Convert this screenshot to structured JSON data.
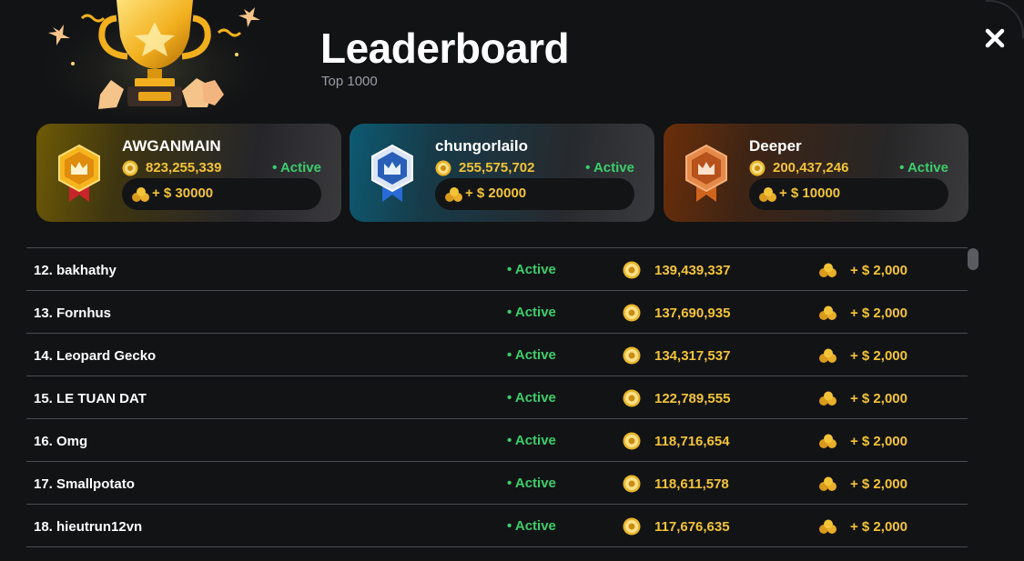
{
  "header": {
    "title": "Leaderboard",
    "subtitle": "Top 1000"
  },
  "icons": {
    "trophy": "trophy-illustration",
    "close": "close-icon",
    "coin": "coin-icon",
    "prize": "prize-coins-icon",
    "gold_badge": "gold-rank-badge",
    "silver_badge": "blue-rank-badge",
    "bronze_badge": "bronze-rank-badge"
  },
  "colors": {
    "gold": "#f3c437",
    "active_green": "#3ccd6c",
    "background": "#121315"
  },
  "top_three": [
    {
      "name": "AWGANMAIN",
      "score": "823,255,339",
      "status": "• Active",
      "prize": "+ $ 30000"
    },
    {
      "name": "chungorlailo",
      "score": "255,575,702",
      "status": "• Active",
      "prize": "+ $ 20000"
    },
    {
      "name": "Deeper",
      "score": "200,437,246",
      "status": "• Active",
      "prize": "+ $ 10000"
    }
  ],
  "rows": [
    {
      "name": "12. bakhathy",
      "status": "• Active",
      "score": "139,439,337",
      "prize": "+ $ 2,000"
    },
    {
      "name": "13. Fornhus",
      "status": "• Active",
      "score": "137,690,935",
      "prize": "+ $ 2,000"
    },
    {
      "name": "14. Leopard Gecko",
      "status": "• Active",
      "score": "134,317,537",
      "prize": "+ $ 2,000"
    },
    {
      "name": "15. LE TUAN DAT",
      "status": "• Active",
      "score": "122,789,555",
      "prize": "+ $ 2,000"
    },
    {
      "name": "16. Omg",
      "status": "• Active",
      "score": "118,716,654",
      "prize": "+ $ 2,000"
    },
    {
      "name": "17. Smallpotato",
      "status": "• Active",
      "score": "118,611,578",
      "prize": "+ $ 2,000"
    },
    {
      "name": "18. hieutrun12vn",
      "status": "• Active",
      "score": "117,676,635",
      "prize": "+ $ 2,000"
    }
  ]
}
